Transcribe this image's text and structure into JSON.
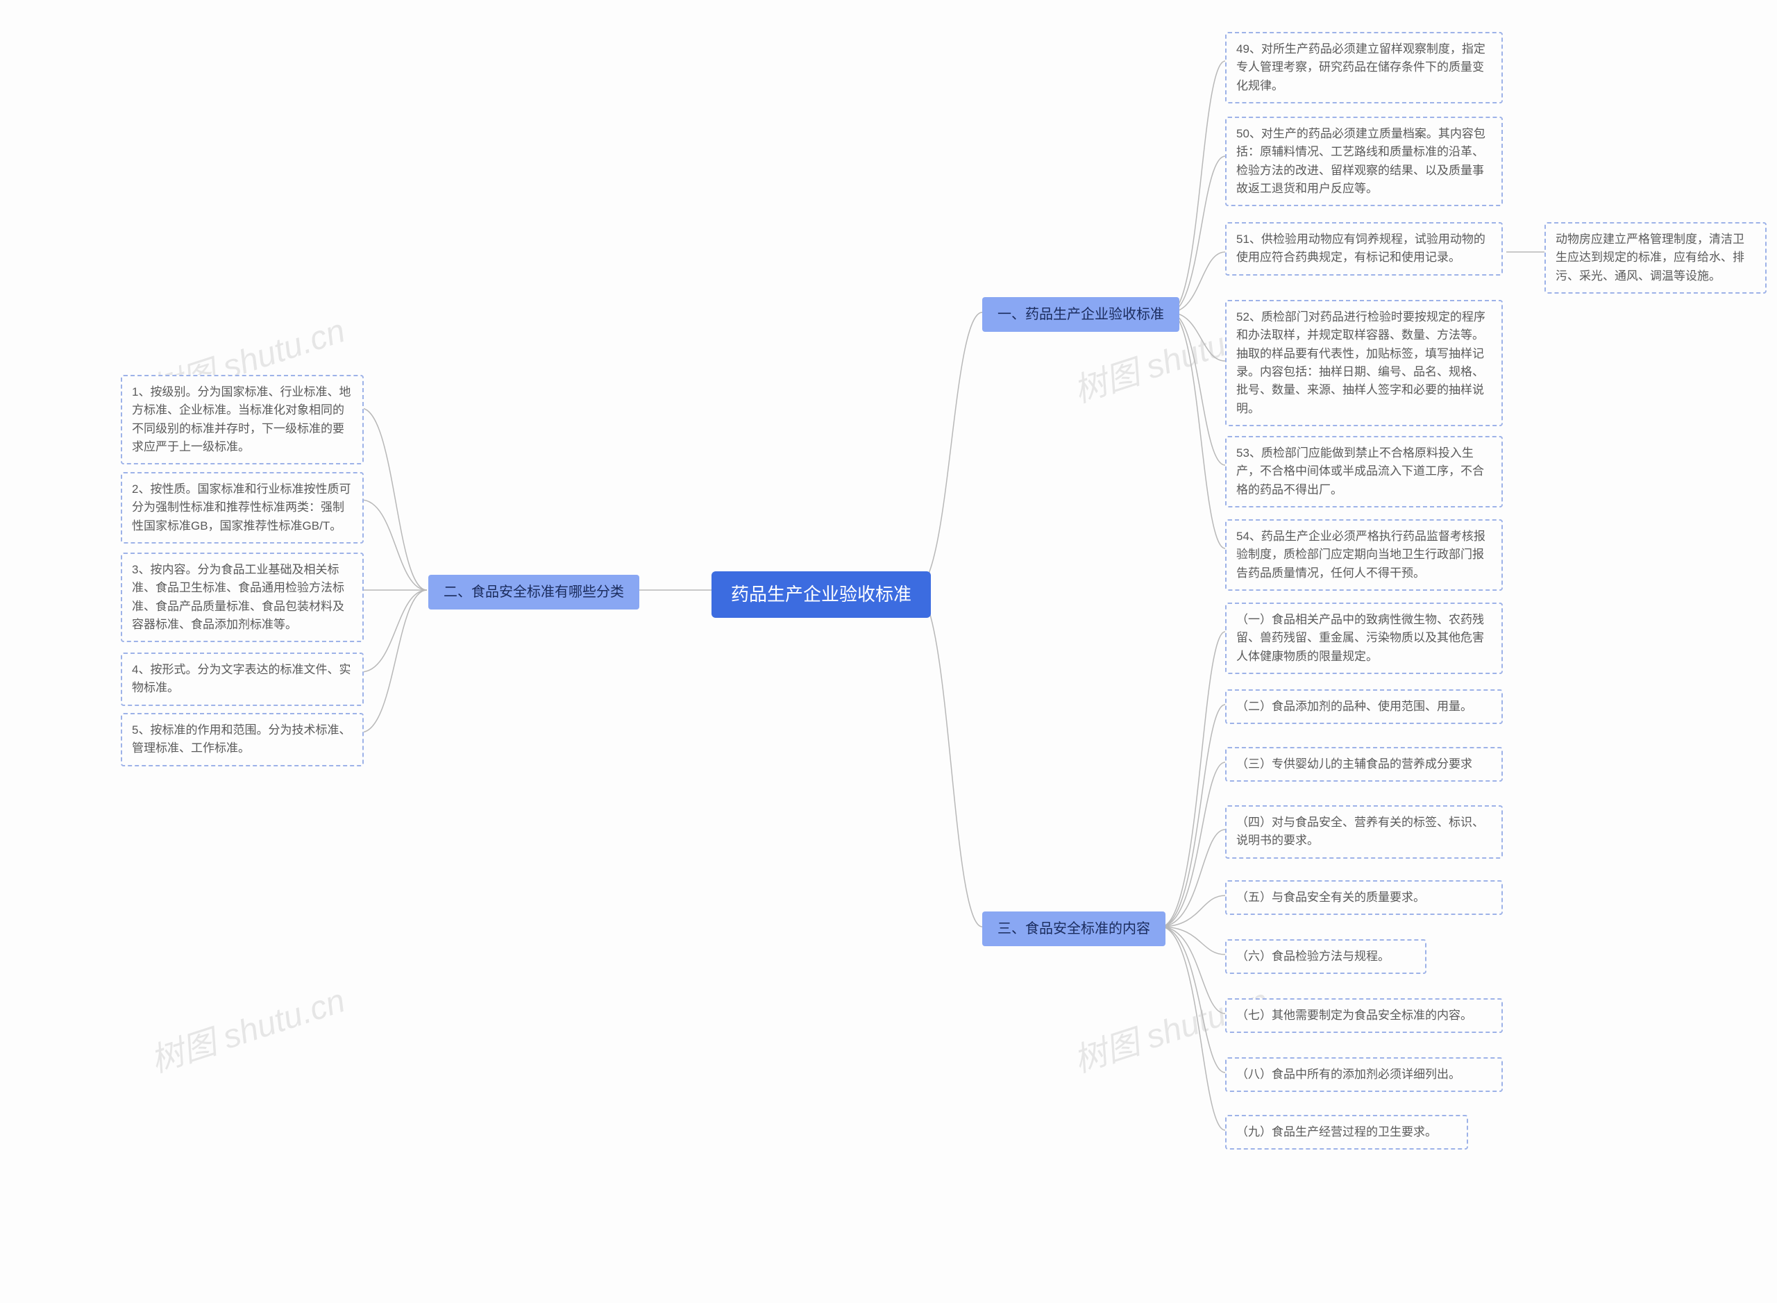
{
  "watermark_text": "树图 shutu.cn",
  "root": {
    "title": "药品生产企业验收标准"
  },
  "branch_left": {
    "title": "二、食品安全标准有哪些分类"
  },
  "branch_right_1": {
    "title": "一、药品生产企业验收标准"
  },
  "branch_right_2": {
    "title": "三、食品安全标准的内容"
  },
  "left_leaves": [
    "1、按级别。分为国家标准、行业标准、地方标准、企业标准。当标准化对象相同的不同级别的标准并存时，下一级标准的要求应严于上一级标准。",
    "2、按性质。国家标准和行业标准按性质可分为强制性标准和推荐性标准两类：强制性国家标准GB，国家推荐性标准GB/T。",
    "3、按内容。分为食品工业基础及相关标准、食品卫生标准、食品通用检验方法标准、食品产品质量标准、食品包装材料及容器标准、食品添加剂标准等。",
    "4、按形式。分为文字表达的标准文件、实物标准。",
    "5、按标准的作用和范围。分为技术标准、管理标准、工作标准。"
  ],
  "right1_leaves": [
    "49、对所生产药品必须建立留样观察制度，指定专人管理考察，研究药品在储存条件下的质量变化规律。",
    "50、对生产的药品必须建立质量档案。其内容包括：原辅料情况、工艺路线和质量标准的沿革、检验方法的改进、留样观察的结果、以及质量事故返工退货和用户反应等。",
    "51、供检验用动物应有饲养规程，试验用动物的使用应符合药典规定，有标记和使用记录。",
    "52、质检部门对药品进行检验时要按规定的程序和办法取样，并规定取样容器、数量、方法等。抽取的样品要有代表性，加贴标签，填写抽样记录。内容包括：抽样日期、编号、品名、规格、批号、数量、来源、抽样人签字和必要的抽样说明。",
    "53、质检部门应能做到禁止不合格原料投入生产，不合格中间体或半成品流入下道工序，不合格的药品不得出厂。",
    "54、药品生产企业必须严格执行药品监督考核报验制度，质检部门应定期向当地卫生行政部门报告药品质量情况，任何人不得干预。"
  ],
  "right1_extra": "动物房应建立严格管理制度，清洁卫生应达到规定的标准，应有给水、排污、采光、通风、调温等设施。",
  "right2_leaves": [
    "（一）食品相关产品中的致病性微生物、农药残留、兽药残留、重金属、污染物质以及其他危害人体健康物质的限量规定。",
    "（二）食品添加剂的品种、使用范围、用量。",
    "（三）专供婴幼儿的主辅食品的营养成分要求",
    "（四）对与食品安全、营养有关的标签、标识、说明书的要求。",
    "（五）与食品安全有关的质量要求。",
    "（六）食品检验方法与规程。",
    "（七）其他需要制定为食品安全标准的内容。",
    "（八）食品中所有的添加剂必须详细列出。",
    "（九）食品生产经营过程的卫生要求。"
  ]
}
